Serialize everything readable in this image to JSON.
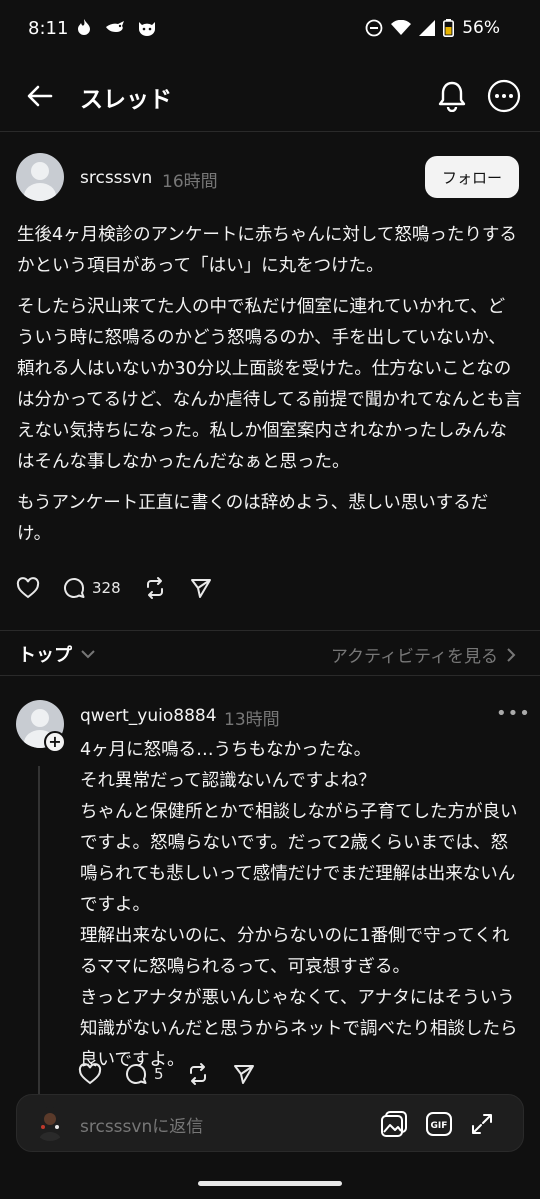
{
  "status_bar": {
    "time": "8:11",
    "battery": "56%",
    "notification_icons": [
      "flame-icon",
      "bird-icon",
      "cat-icon"
    ]
  },
  "header": {
    "title": "スレッド"
  },
  "post": {
    "username": "srcsssvn",
    "time": "16時間",
    "follow_label": "フォロー",
    "paragraphs": [
      "生後4ヶ月検診のアンケートに赤ちゃんに対して怒鳴ったりするかという項目があって「はい」に丸をつけた。",
      "そしたら沢山来てた人の中で私だけ個室に連れていかれて、どういう時に怒鳴るのかどう怒鳴るのか、手を出していないか、頼れる人はいないか30分以上面談を受けた。仕方ないことなのは分かってるけど、なんか虐待してる前提で聞かれてなんとも言えない気持ちになった。私しか個室案内されなかったしみんなはそんな事しなかったんだなぁと思った。",
      "もうアンケート正直に書くのは辞めよう、悲しい思いするだけ。"
    ],
    "reply_count": "328"
  },
  "sort": {
    "label": "トップ",
    "activity_link": "アクティビティを見る"
  },
  "reply": {
    "username": "qwert_yuio8884",
    "time": "13時間",
    "more": "•••",
    "lines": [
      "4ヶ月に怒鳴る…うちもなかったな。",
      "それ異常だって認識ないんですよね？",
      "ちゃんと保健所とかで相談しながら子育てした方が良いですよ。怒鳴らないです。だって2歳くらいまでは、怒鳴られても悲しいって感情だけでまだ理解は出来ないんですよ。",
      "理解出来ないのに、分からないのに1番側で守ってくれるママに怒鳴られるって、可哀想すぎる。",
      "きっとアナタが悪いんじゃなくて、アナタにはそういう知識がないんだと思うからネットで調べたり相談したら良いですよ。"
    ],
    "reply_count": "5"
  },
  "reply_bar": {
    "placeholder": "srcsssvnに返信",
    "gif_label": "GIF"
  },
  "colors": {
    "background": "#101010",
    "text": "#f3f3f3",
    "muted": "#777777",
    "divider": "#2a2a2a"
  }
}
